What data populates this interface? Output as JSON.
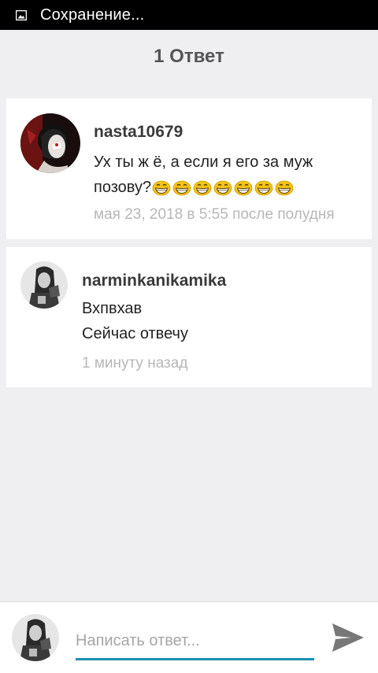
{
  "status_bar": {
    "icon": "image-icon",
    "text": "Сохранение..."
  },
  "header": {
    "title": "1 Ответ"
  },
  "comments": [
    {
      "username": "nasta10679",
      "message_line1": "Ух ты ж ё, а если я его за муж",
      "message_line2": "позову?",
      "emoji": "grinning-face-emoji",
      "emoji_count": 7,
      "time": "мая 23, 2018 в 5:55 после полудня"
    },
    {
      "username": "narminkanikamika",
      "message_line1": "Вхпвхав",
      "message_line2": "Сейчас отвечу",
      "time": "1 минуту назад"
    }
  ],
  "reply": {
    "placeholder": "Написать ответ...",
    "send_icon": "send-icon"
  },
  "colors": {
    "background": "#efeef0",
    "accent": "#1d8fb0",
    "timestamp": "#b7b7b7"
  }
}
